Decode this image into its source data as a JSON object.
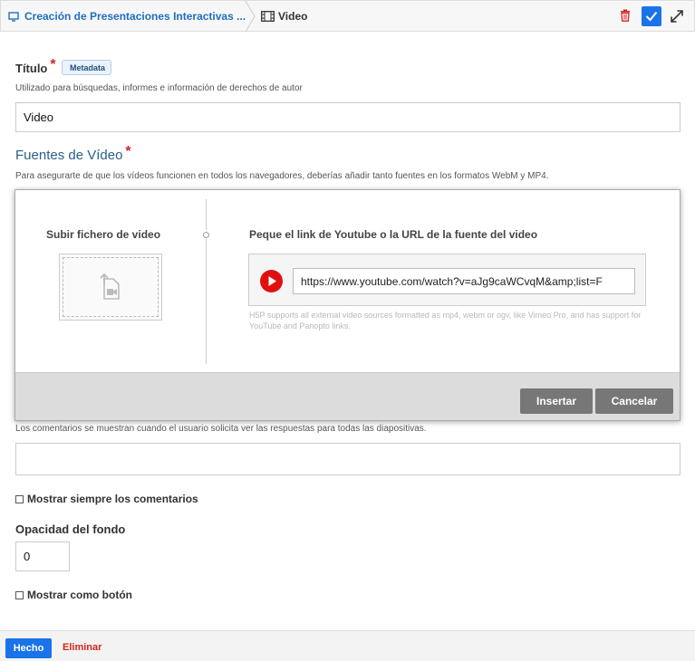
{
  "header": {
    "breadcrumb_parent": "Creación de Presentaciones Interactivas ...",
    "breadcrumb_current": "Video"
  },
  "title_field": {
    "label": "Título",
    "required_mark": "*",
    "badge": "Metadata",
    "help": "Utilizado para búsquedas, informes e información de derechos de autor",
    "value": "Video"
  },
  "sources": {
    "label": "Fuentes de Vídeo",
    "required_mark": "*",
    "help": "Para asegurarte de que los vídeos funcionen en todos los navegadores, deberías añadir tanto fuentes en los formatos WebM y MP4."
  },
  "dialog": {
    "upload_title": "Subir fichero de video",
    "url_title": "Peque el link de Youtube o la URL de la fuente del video",
    "url_value": "https://www.youtube.com/watch?v=aJg9caWCvqM&amp;list=F",
    "url_help": "H5P supports all external video sources formatted as mp4, webm or ogv, like Vimeo Pro, and has support for YouTube and Panopto links.",
    "insert_label": "Insertar",
    "cancel_label": "Cancelar"
  },
  "comments": {
    "help": "Los comentarios se muestran cuando el usuario solicita ver las respuestas para todas las diapositivas.",
    "value": ""
  },
  "always_show_comments": {
    "label": "Mostrar siempre los comentarios",
    "checked": false
  },
  "bg_opacity": {
    "label": "Opacidad del fondo",
    "value": "0"
  },
  "show_as_button": {
    "label": "Mostrar como botón",
    "checked": false
  },
  "footer": {
    "done_label": "Hecho",
    "delete_label": "Eliminar"
  },
  "colors": {
    "accent": "#1a73e8",
    "danger": "#d6241f",
    "section": "#2b5f8c",
    "youtube": "#e01010"
  }
}
